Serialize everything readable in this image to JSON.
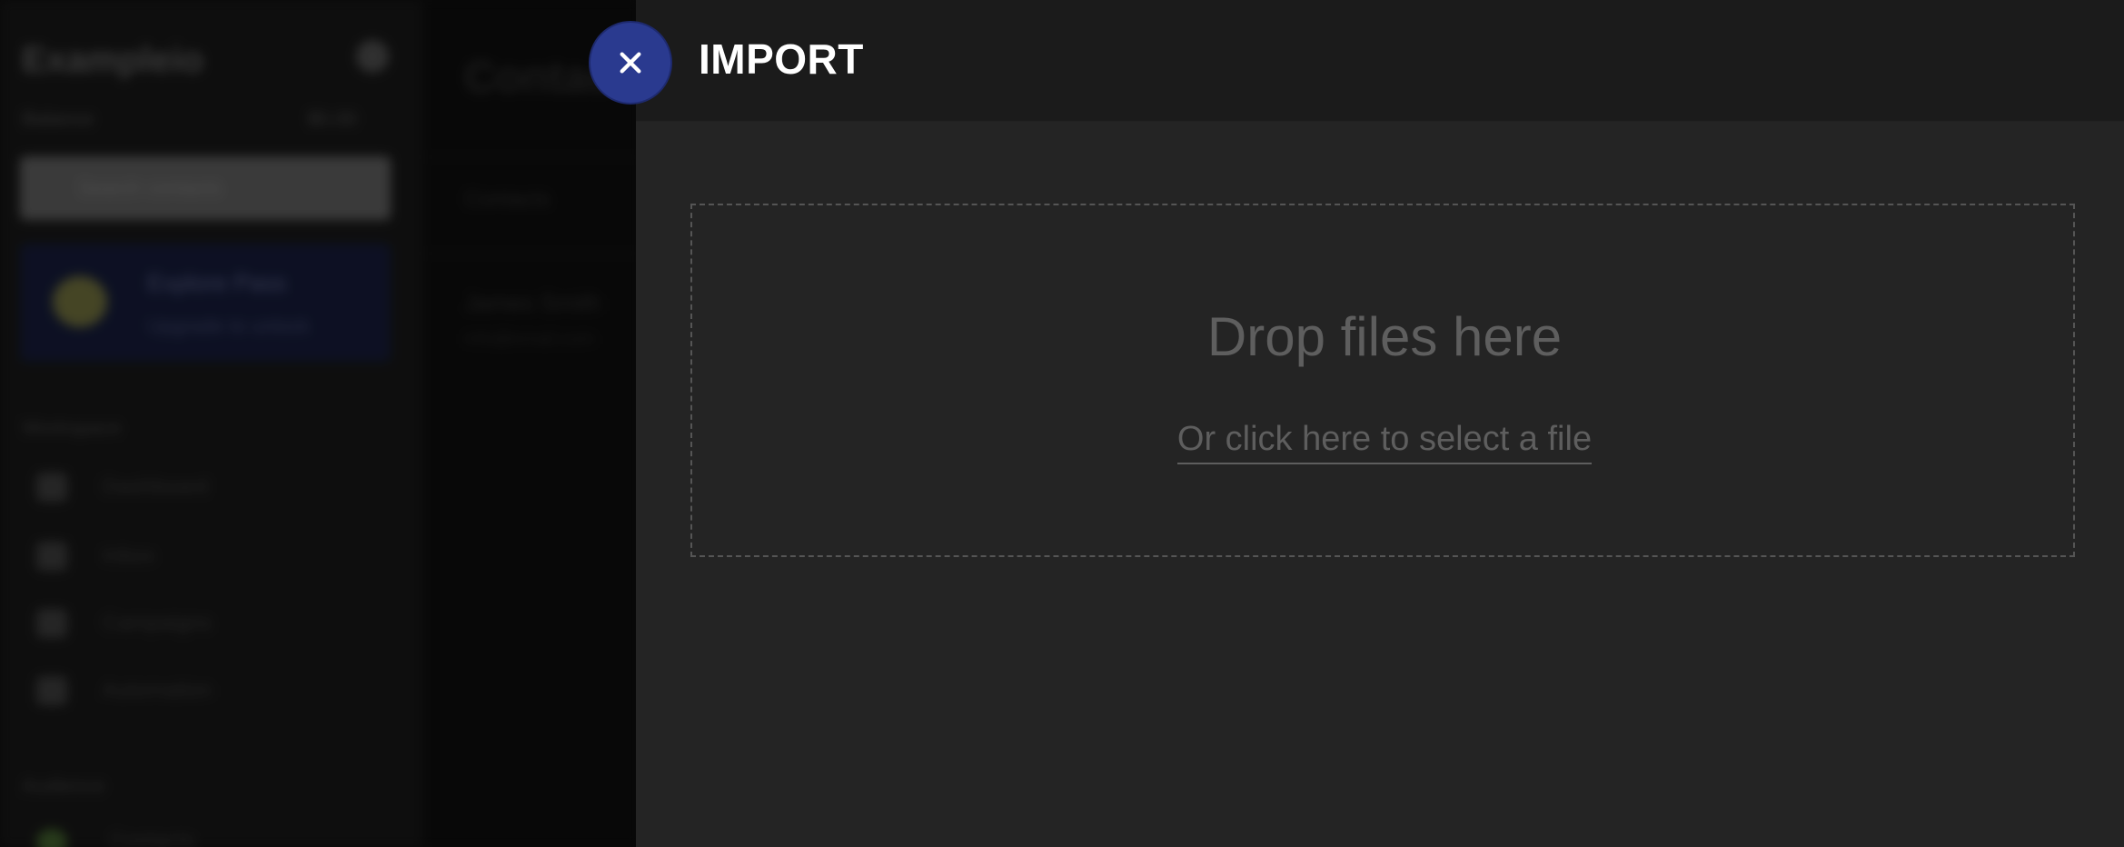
{
  "background": {
    "brand": "Exampleio",
    "balance_label": "Balance",
    "balance_value": "$0.00",
    "search_placeholder": "Search contacts",
    "promo_title": "Explore Pass",
    "promo_subtitle": "Upgrade to unlock",
    "workspace_label": "Workspace",
    "nav_items": [
      {
        "label": "Dashboard"
      },
      {
        "label": "Inbox"
      },
      {
        "label": "Campaigns"
      },
      {
        "label": "Automation"
      }
    ],
    "audience_label": "Audience",
    "audience_item": "Contacts",
    "middle_title": "Contacts",
    "middle_row1": "Contacts",
    "middle_row2": "James Smith",
    "middle_row3": "info@email.com"
  },
  "import": {
    "title": "IMPORT",
    "drop_title": "Drop files here",
    "drop_link": "Or click here to select a file"
  },
  "colors": {
    "close_button": "#2a3a8f",
    "panel_bg": "#242424",
    "header_bg": "#1b1b1b"
  },
  "icons": {
    "close": "close-icon"
  }
}
